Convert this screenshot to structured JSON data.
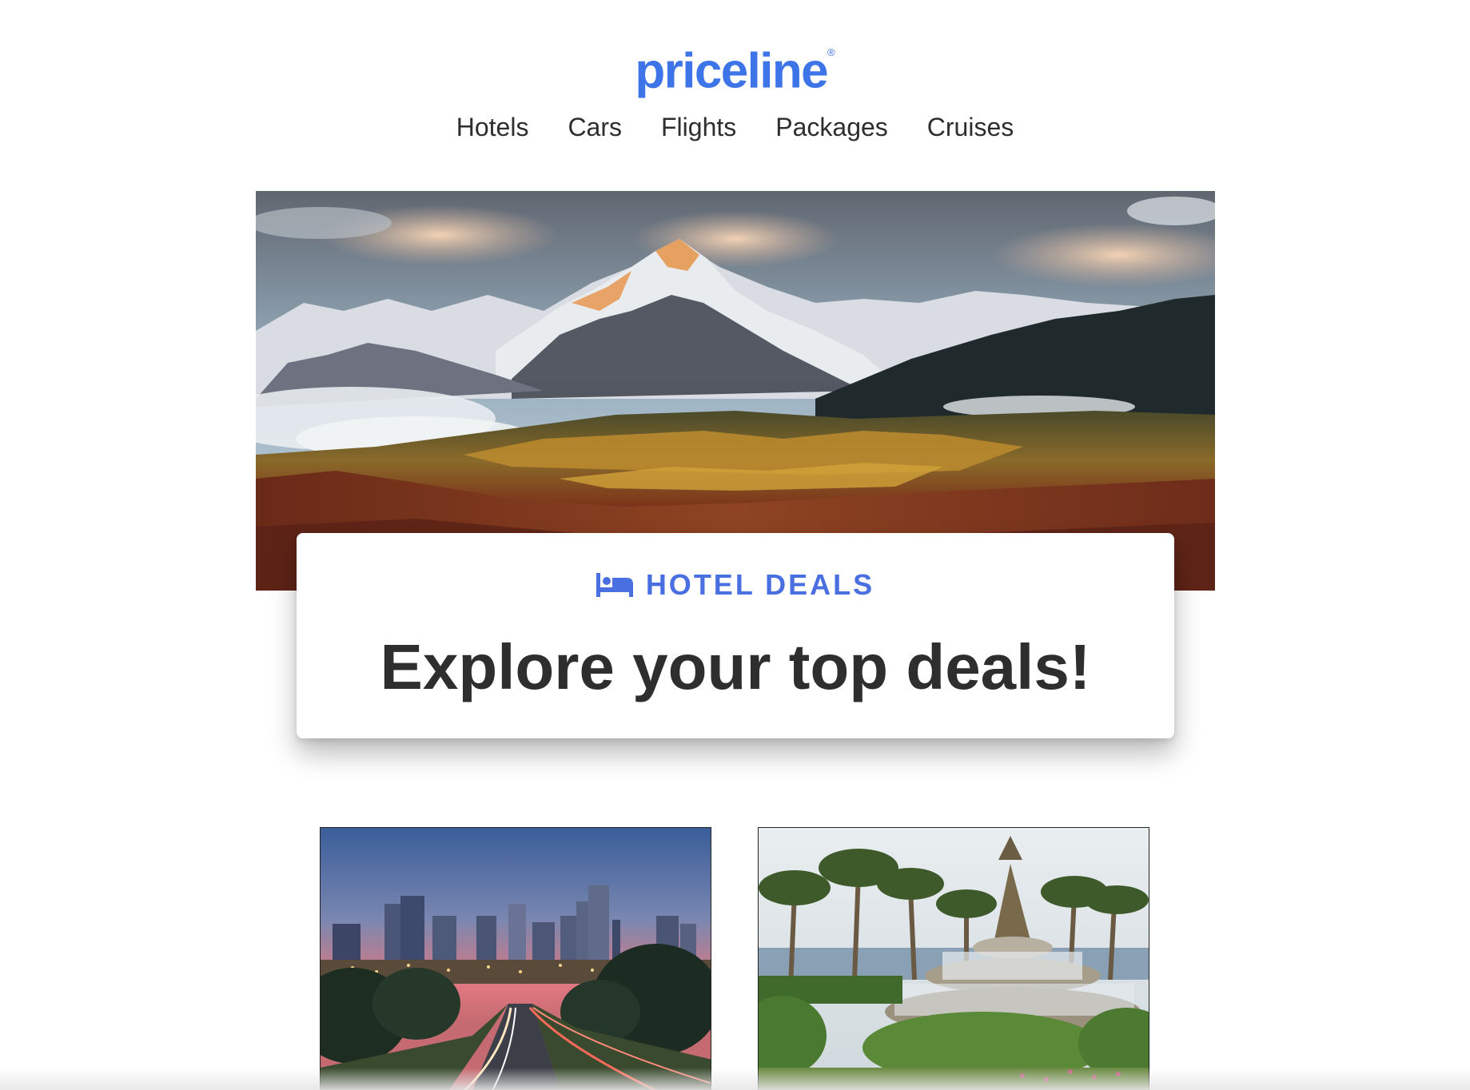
{
  "brand": {
    "logo_text": "priceline",
    "logo_mark": "®",
    "color": "#3d74e8"
  },
  "nav": {
    "items": [
      {
        "label": "Hotels"
      },
      {
        "label": "Cars"
      },
      {
        "label": "Flights"
      },
      {
        "label": "Packages"
      },
      {
        "label": "Cruises"
      }
    ]
  },
  "hero": {
    "image": "mountain-landscape-photo"
  },
  "deal_card": {
    "icon": "bed-icon",
    "eyebrow": "HOTEL DEALS",
    "headline": "Explore your top deals!",
    "accent_color": "#4a6fe0"
  },
  "thumbnails": [
    {
      "image": "city-skyline-dusk-photo"
    },
    {
      "image": "pineapple-fountain-photo"
    }
  ]
}
